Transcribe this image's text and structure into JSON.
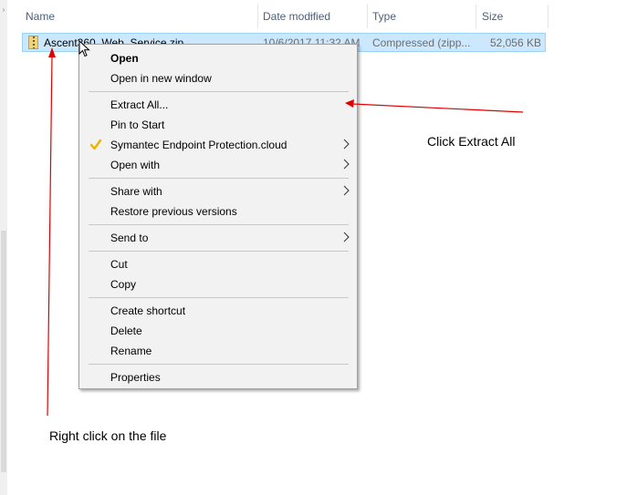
{
  "columns": {
    "name": "Name",
    "date_modified": "Date modified",
    "type": "Type",
    "size": "Size"
  },
  "file": {
    "name": "Ascent360_Web_Service.zip",
    "date_modified": "10/6/2017 11:32 AM",
    "type": "Compressed (zipp...",
    "size": "52,056 KB"
  },
  "context_menu": {
    "open": "Open",
    "open_new_window": "Open in new window",
    "extract_all": "Extract All...",
    "pin_to_start": "Pin to Start",
    "symantec": "Symantec Endpoint Protection.cloud",
    "open_with": "Open with",
    "share_with": "Share with",
    "restore_previous": "Restore previous versions",
    "send_to": "Send to",
    "cut": "Cut",
    "copy": "Copy",
    "create_shortcut": "Create shortcut",
    "delete": "Delete",
    "rename": "Rename",
    "properties": "Properties"
  },
  "annotations": {
    "click_extract_all": "Click Extract All",
    "right_click_file": "Right click on the file",
    "arrow_color": "#e00000"
  },
  "icons": {
    "file": "zip-folder-icon",
    "symantec": "checkmark-icon",
    "submenu": "chevron-right-icon",
    "cursor": "mouse-pointer-icon"
  }
}
